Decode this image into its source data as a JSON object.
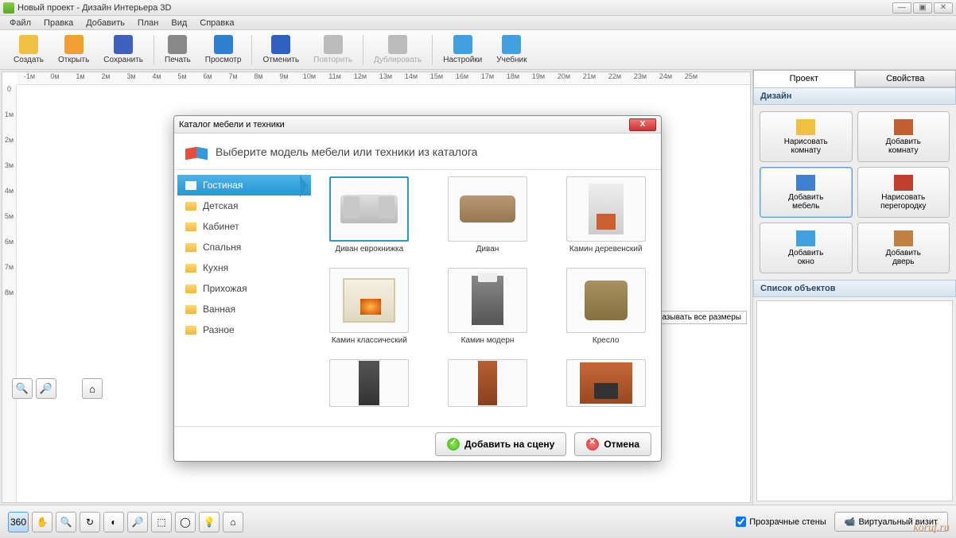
{
  "window": {
    "title": "Новый проект - Дизайн Интерьера 3D"
  },
  "menu": [
    "Файл",
    "Правка",
    "Добавить",
    "План",
    "Вид",
    "Справка"
  ],
  "toolbar": [
    {
      "label": "Создать",
      "icon": "#f0c040",
      "name": "new-button"
    },
    {
      "label": "Открыть",
      "icon": "#f0a030",
      "name": "open-button"
    },
    {
      "label": "Сохранить",
      "icon": "#4060c0",
      "name": "save-button"
    },
    {
      "sep": true
    },
    {
      "label": "Печать",
      "icon": "#888",
      "name": "print-button"
    },
    {
      "label": "Просмотр",
      "icon": "#3080d0",
      "name": "preview-button"
    },
    {
      "sep": true
    },
    {
      "label": "Отменить",
      "icon": "#3060c0",
      "name": "undo-button"
    },
    {
      "label": "Повторить",
      "icon": "#bbb",
      "name": "redo-button",
      "disabled": true
    },
    {
      "sep": true
    },
    {
      "label": "Дублировать",
      "icon": "#bbb",
      "name": "duplicate-button",
      "disabled": true
    },
    {
      "sep": true
    },
    {
      "label": "Настройки",
      "icon": "#40a0e0",
      "name": "settings-button"
    },
    {
      "label": "Учебник",
      "icon": "#40a0e0",
      "name": "tutorial-button"
    }
  ],
  "ruler_h": [
    "-1м",
    "0м",
    "1м",
    "2м",
    "3м",
    "4м",
    "5м",
    "6м",
    "7м",
    "8м",
    "9м",
    "10м",
    "11м",
    "12м",
    "13м",
    "14м",
    "15м",
    "16м",
    "17м",
    "18м",
    "19м",
    "20м",
    "21м",
    "22м",
    "23м",
    "24м",
    "25м"
  ],
  "ruler_v": [
    "0",
    "1м",
    "2м",
    "3м",
    "4м",
    "5м",
    "6м",
    "7м",
    "8м"
  ],
  "dim_label": "Показывать все размеры",
  "tabs": {
    "project": "Проект",
    "properties": "Свойства"
  },
  "design_section": "Дизайн",
  "design_buttons": [
    {
      "l1": "Нарисовать",
      "l2": "комнату",
      "name": "draw-room-button"
    },
    {
      "l1": "Добавить",
      "l2": "комнату",
      "name": "add-room-button"
    },
    {
      "l1": "Добавить",
      "l2": "мебель",
      "name": "add-furniture-button",
      "sel": true
    },
    {
      "l1": "Нарисовать",
      "l2": "перегородку",
      "name": "draw-partition-button"
    },
    {
      "l1": "Добавить",
      "l2": "окно",
      "name": "add-window-button"
    },
    {
      "l1": "Добавить",
      "l2": "дверь",
      "name": "add-door-button"
    }
  ],
  "objects_section": "Список объектов",
  "bottom": {
    "transparent_walls": "Прозрачные стены",
    "virtual_visit": "Виртуальный визит"
  },
  "watermark": "koruf.ru",
  "dialog": {
    "title": "Каталог мебели и техники",
    "header": "Выберите модель мебели или техники из каталога",
    "categories": [
      "Гостиная",
      "Детская",
      "Кабинет",
      "Спальня",
      "Кухня",
      "Прихожая",
      "Ванная",
      "Разное"
    ],
    "items": [
      {
        "label": "Диван еврокнижка",
        "shape": "sofa1",
        "sel": true
      },
      {
        "label": "Диван",
        "shape": "sofa2"
      },
      {
        "label": "Камин деревенский",
        "shape": "fire1"
      },
      {
        "label": "Камин классический",
        "shape": "fire2"
      },
      {
        "label": "Камин модерн",
        "shape": "fire3"
      },
      {
        "label": "Кресло",
        "shape": "chair"
      },
      {
        "label": "",
        "shape": "shelf1",
        "cut": true
      },
      {
        "label": "",
        "shape": "shelf2",
        "cut": true
      },
      {
        "label": "",
        "shape": "shelf3",
        "cut": true
      }
    ],
    "add_btn": "Добавить на сцену",
    "cancel_btn": "Отмена"
  }
}
